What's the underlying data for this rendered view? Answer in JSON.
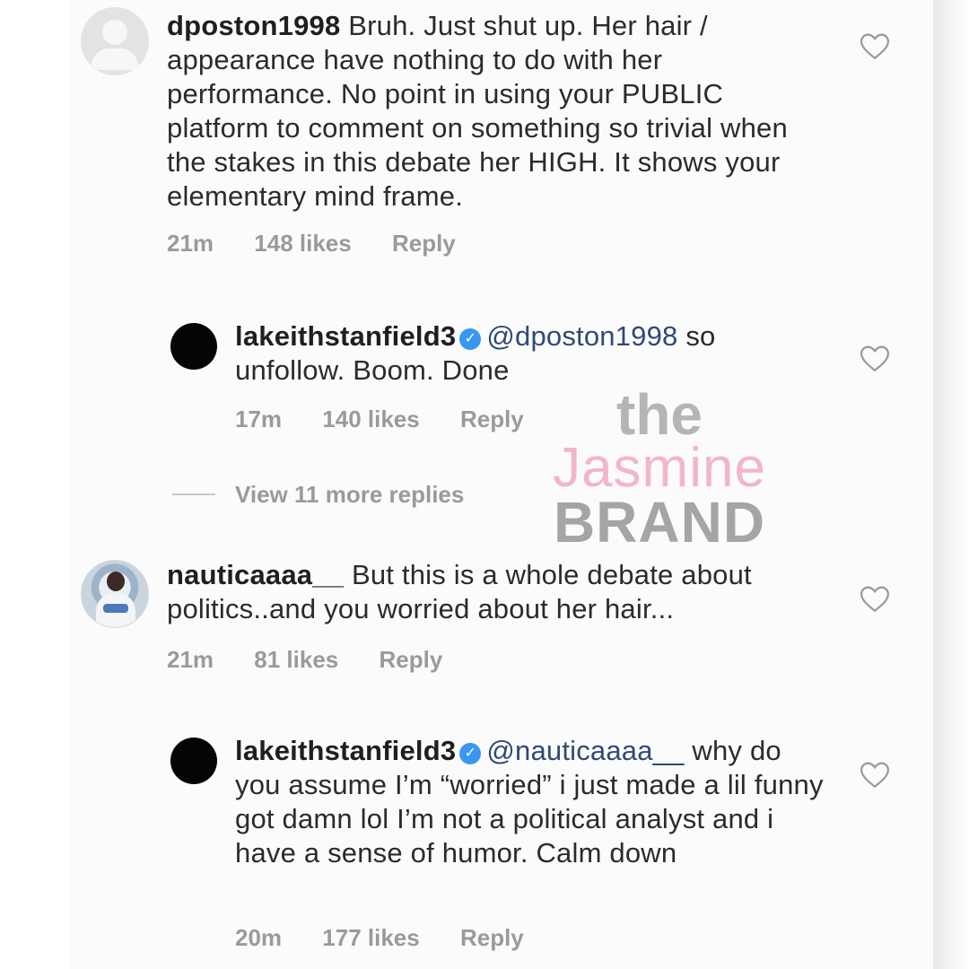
{
  "comments": [
    {
      "username": "dposton1998",
      "verified": false,
      "avatar": "default-user-avatar",
      "text": "Bruh. Just shut up. Her hair / appearance have nothing to do with her performance.  No point in using your PUBLIC platform to comment on something so trivial when the stakes in this debate her HIGH. It shows your elementary mind frame.",
      "time": "21m",
      "likes": "148 likes",
      "reply_label": "Reply"
    },
    {
      "username": "lakeithstanfield3",
      "verified": true,
      "avatar": "black-avatar",
      "mention": "@dposton1998",
      "text": "so unfollow. Boom. Done",
      "time": "17m",
      "likes": "140 likes",
      "reply_label": "Reply"
    },
    {
      "username": "nauticaaaa__",
      "verified": false,
      "avatar": "photo-avatar",
      "text": "But this is a whole debate about politics..and you worried about her hair...",
      "time": "21m",
      "likes": "81 likes",
      "reply_label": "Reply"
    },
    {
      "username": "lakeithstanfield3",
      "verified": true,
      "avatar": "black-avatar",
      "mention": "@nauticaaaa__",
      "text": "why do you assume I’m “worried” i just made a lil funny got damn lol I’m not a political analyst and i have a sense of humor. Calm down",
      "time": "20m",
      "likes": "177 likes",
      "reply_label": "Reply"
    }
  ],
  "view_more_replies": "View 11 more replies",
  "watermark": {
    "line1": "the",
    "line2": "Jasmine",
    "line3": "BRAND"
  },
  "colors": {
    "verified": "#3897f0",
    "meta": "#9a9a9a",
    "watermark_pink": "#f2b6c6"
  },
  "icons": {
    "like": "heart-outline-icon",
    "verified": "verified-badge-icon"
  }
}
